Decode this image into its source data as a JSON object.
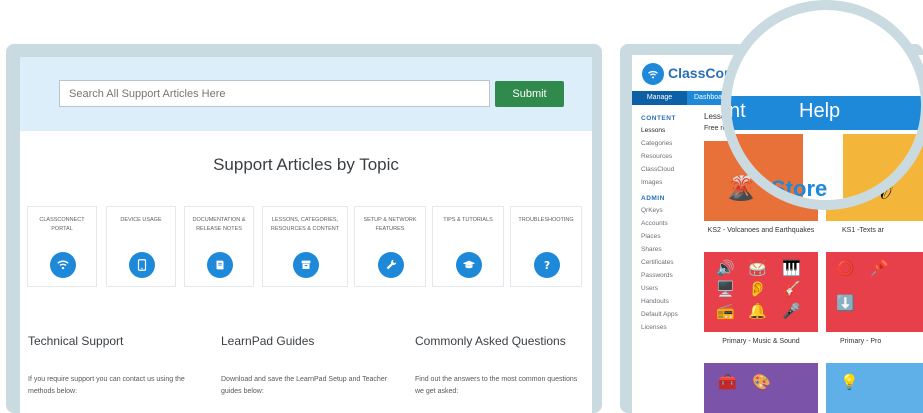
{
  "support": {
    "search_placeholder": "Search All Support Articles Here",
    "submit_label": "Submit",
    "section_title": "Support Articles by Topic",
    "topics": [
      {
        "label": "CLASSCONNECT PORTAL",
        "icon": "wifi-icon"
      },
      {
        "label": "DEVICE USAGE",
        "icon": "tablet-icon"
      },
      {
        "label": "DOCUMENTATION & RELEASE NOTES",
        "icon": "book-icon"
      },
      {
        "label": "LESSONS, CATEGORIES, RESOURCES & CONTENT",
        "icon": "archive-icon"
      },
      {
        "label": "SETUP & NETWORK FEATURES",
        "icon": "wrench-icon"
      },
      {
        "label": "TIPS & TUTORIALS",
        "icon": "graduation-cap-icon"
      },
      {
        "label": "TROUBLESHOOTING",
        "icon": "question-icon"
      }
    ],
    "columns": [
      {
        "title": "Technical Support",
        "text": "If you require support you can contact us using the methods below:"
      },
      {
        "title": "LearnPad Guides",
        "text": "Download and save the LearnPad Setup and Teacher guides below:"
      },
      {
        "title": "Commonly Asked Questions",
        "text": "Find out the answers to the most common questions we get asked:"
      }
    ],
    "accent_color": "#1e88d9",
    "submit_color": "#2f8a4b"
  },
  "dashboard": {
    "logo_text": "ClassCon",
    "nav": {
      "manage": "Manage",
      "dashboard": "Dashboa"
    },
    "content_heading": "CONTENT",
    "content_items": [
      "Lessons",
      "Categories",
      "Resources",
      "ClassCloud",
      "Images"
    ],
    "admin_heading": "ADMIN",
    "admin_items": [
      "QrKeys",
      "Accounts",
      "Places",
      "Shares",
      "Certificates",
      "Passwords",
      "Users",
      "Handouts",
      "Default Apps",
      "Licenses"
    ],
    "breadcrumb": "Lesso",
    "subheading": "Free re",
    "tiles": [
      {
        "caption": "KS2 - Volcanoes and Earthquakes",
        "color": "#e8713a"
      },
      {
        "caption": "KS1 -Texts ar",
        "color": "#f3b53a"
      },
      {
        "caption": "Primary - Music & Sound",
        "color": "#e8404a"
      },
      {
        "caption": "Primary - Pro",
        "color": "#e8404a"
      }
    ],
    "magnifier": {
      "nav_left": "nt",
      "nav_help": "Help",
      "store_text": "Store"
    }
  }
}
